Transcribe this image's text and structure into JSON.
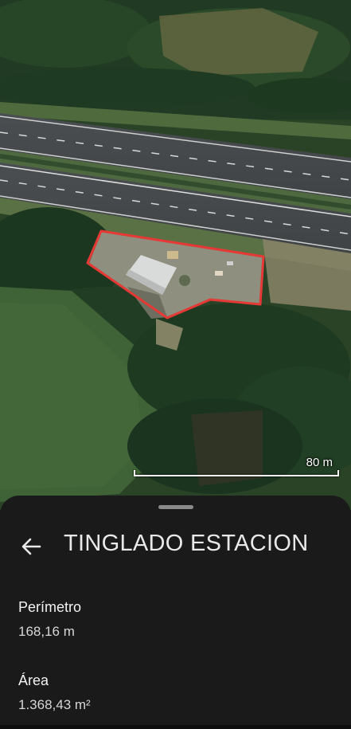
{
  "map": {
    "scale_label": "80 m",
    "polygon_color": "#e53935"
  },
  "sheet": {
    "title": "TINGLADO ESTACION",
    "measurements": [
      {
        "label": "Perímetro",
        "value": "168,16 m"
      },
      {
        "label": "Área",
        "value": "1.368,43 m²"
      }
    ]
  },
  "icons": {
    "back": "arrow-left-icon"
  }
}
